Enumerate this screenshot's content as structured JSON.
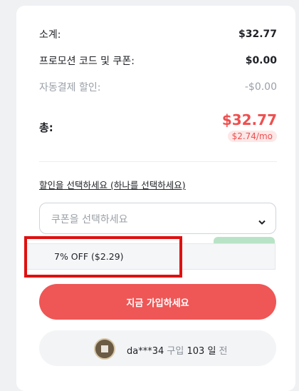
{
  "summary": {
    "subtotal_label": "소계:",
    "subtotal_value": "$32.77",
    "promo_label": "프로모션 코드 및 쿠폰:",
    "promo_value": "$0.00",
    "autopay_label": "자동결제 할인:",
    "autopay_value": "-$0.00",
    "total_label": "총:",
    "total_value": "$32.77",
    "per_month": "$2.74/mo"
  },
  "discount": {
    "label": "할인을 선택하세요 (하나를 선택하세요)",
    "placeholder": "쿠폰을 선택하세요",
    "options": [
      "7% OFF ($2.29)"
    ]
  },
  "cta": {
    "label": "지금 가입하세요"
  },
  "social_proof": {
    "user": "da***34",
    "action": "구입",
    "ago_number": "103",
    "unit": "일",
    "suffix": "전"
  },
  "colors": {
    "accent": "#ef5656",
    "highlight": "#e01010"
  }
}
